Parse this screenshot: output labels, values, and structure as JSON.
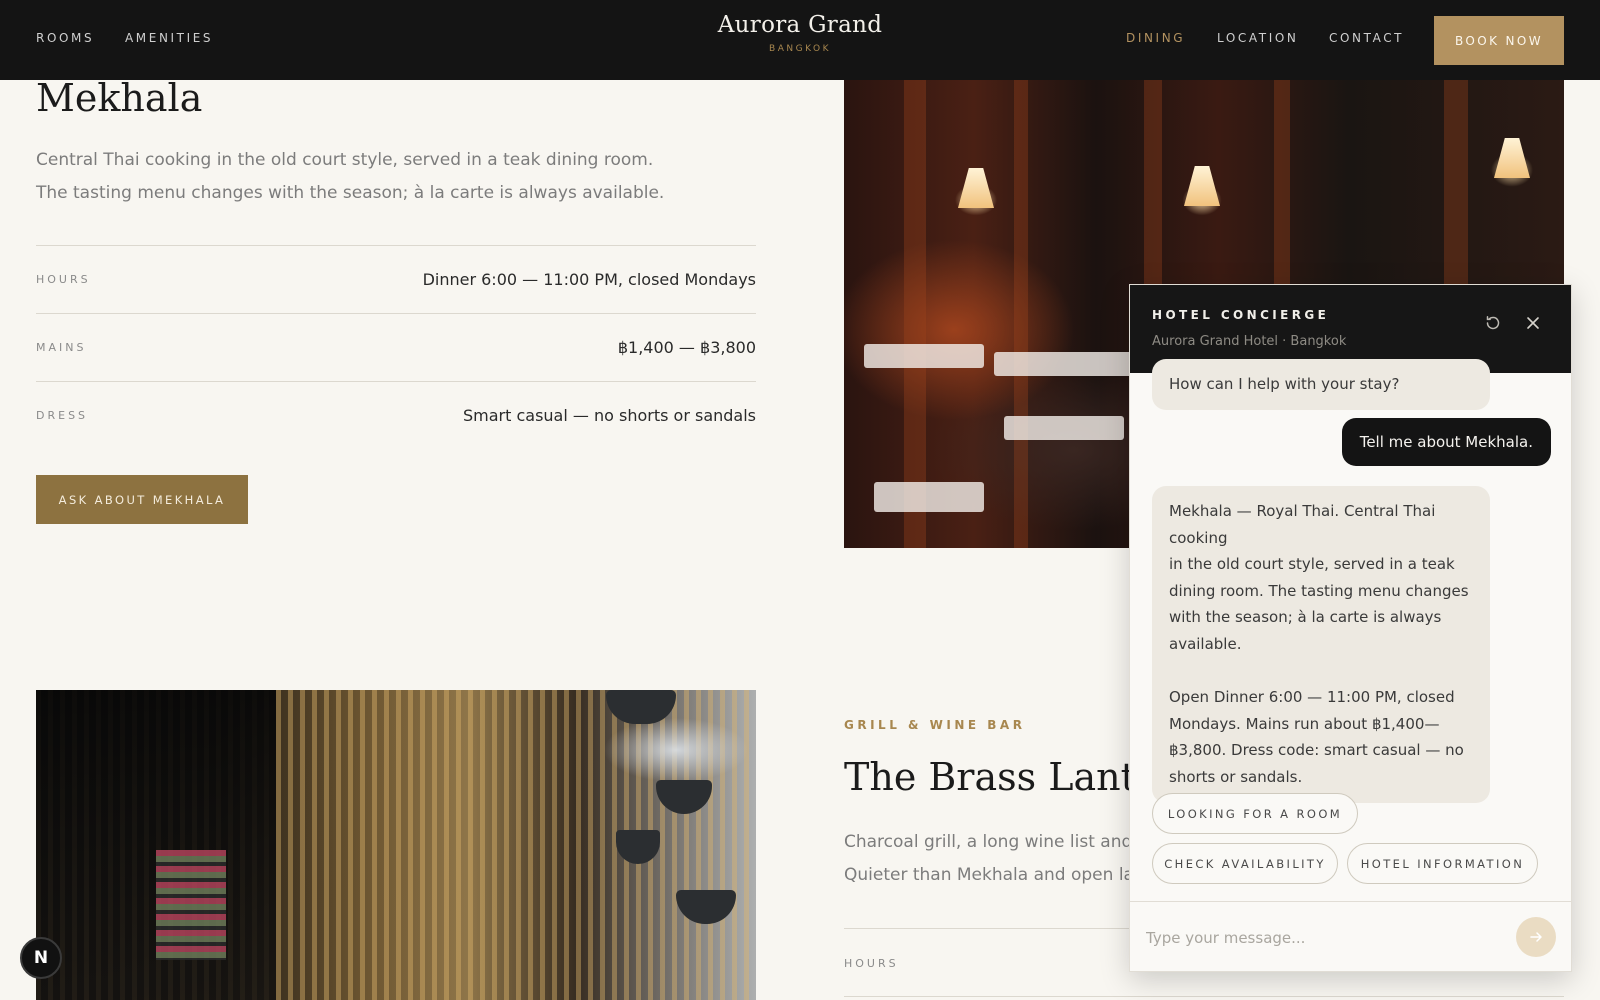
{
  "nav": {
    "left": [
      "ROOMS",
      "AMENITIES"
    ],
    "right": [
      "DINING",
      "LOCATION",
      "CONTACT"
    ],
    "active": "DINING",
    "book_label": "BOOK NOW"
  },
  "brand": {
    "name": "Aurora Grand",
    "city": "BANGKOK"
  },
  "mekhala": {
    "title": "Mekhala",
    "description": [
      "Central Thai cooking in the old court style, served in a teak dining room.",
      "The tasting menu changes with the season; à la carte is always available."
    ],
    "details": [
      {
        "label": "HOURS",
        "value": "Dinner 6:00 — 11:00 PM, closed Mondays"
      },
      {
        "label": "MAINS",
        "value": "฿1,400 — ฿3,800"
      },
      {
        "label": "DRESS",
        "value": "Smart casual — no shorts or sandals"
      }
    ],
    "ask_label": "ASK ABOUT MEKHALA"
  },
  "brass_lantern": {
    "eyebrow": "GRILL & WINE BAR",
    "title": "The Brass Lantern",
    "description": [
      "Charcoal grill, a long wine list and cocktails.",
      "Quieter than Mekhala and open later."
    ],
    "hours_label": "HOURS"
  },
  "chat": {
    "title": "HOTEL CONCIERGE",
    "subtitle": "Aurora Grand Hotel · Bangkok",
    "messages": [
      {
        "role": "bot",
        "text": "How can I help with your stay?"
      },
      {
        "role": "user",
        "text": "Tell me about Mekhala."
      },
      {
        "role": "bot",
        "text": "Mekhala — Royal Thai. Central Thai cooking\nin the old court style, served in a teak\ndining room. The tasting menu changes\nwith the season; à la carte is always\navailable.\n\nOpen Dinner 6:00 — 11:00 PM, closed\nMondays. Mains run about ฿1,400—\n฿3,800. Dress code: smart casual — no\nshorts or sandals."
      }
    ],
    "chips": [
      "LOOKING FOR A ROOM",
      "CHECK AVAILABILITY",
      "HOTEL INFORMATION"
    ],
    "input_placeholder": "Type your message..."
  },
  "dev_badge": "N",
  "icons": [
    "refresh-icon",
    "close-icon",
    "send-arrow-icon"
  ],
  "colors": {
    "accent": "#b39260",
    "header_bg": "#141414",
    "page_bg": "#f8f6f1"
  }
}
